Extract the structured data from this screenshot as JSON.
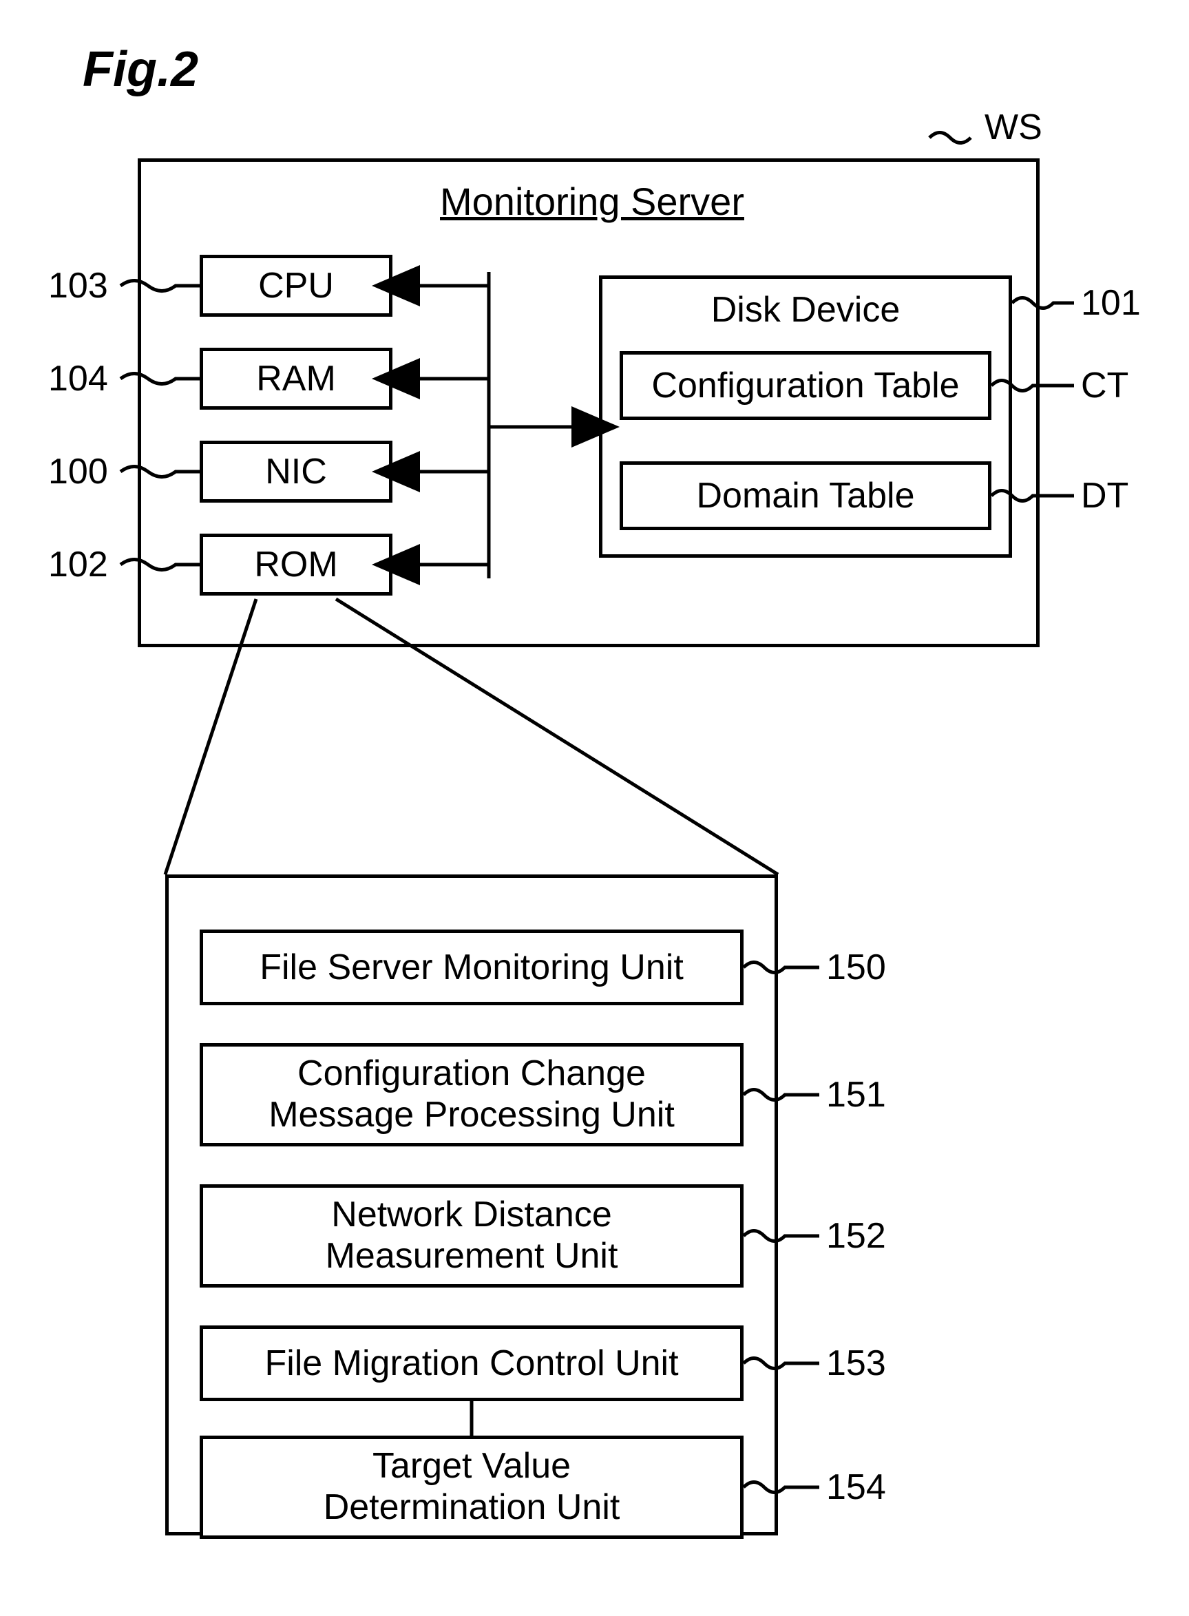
{
  "figure_title": "Fig.2",
  "main_box_title": "Monitoring Server",
  "main_box_label": "WS",
  "components": {
    "cpu": {
      "text": "CPU",
      "ref": "103"
    },
    "ram": {
      "text": "RAM",
      "ref": "104"
    },
    "nic": {
      "text": "NIC",
      "ref": "100"
    },
    "rom": {
      "text": "ROM",
      "ref": "102"
    }
  },
  "disk": {
    "title": "Disk Device",
    "ref": "101",
    "config_table": {
      "text": "Configuration Table",
      "ref": "CT"
    },
    "domain_table": {
      "text": "Domain Table",
      "ref": "DT"
    }
  },
  "rom_detail": {
    "u150": {
      "text": "File Server Monitoring Unit",
      "ref": "150"
    },
    "u151": {
      "text": "Configuration Change\nMessage Processing Unit",
      "ref": "151"
    },
    "u152": {
      "text": "Network Distance\nMeasurement Unit",
      "ref": "152"
    },
    "u153": {
      "text": "File Migration Control Unit",
      "ref": "153"
    },
    "u154": {
      "text": "Target Value\nDetermination Unit",
      "ref": "154"
    }
  }
}
